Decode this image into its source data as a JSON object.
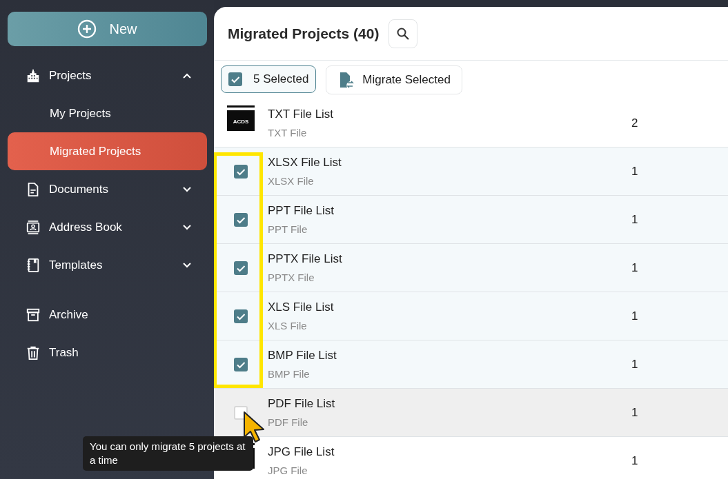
{
  "sidebar": {
    "new_button": "New",
    "items": [
      {
        "label": "Projects",
        "expanded": true,
        "children": [
          {
            "label": "My Projects",
            "selected": false
          },
          {
            "label": "Migrated Projects",
            "selected": true
          }
        ]
      },
      {
        "label": "Documents",
        "expanded": false
      },
      {
        "label": "Address Book",
        "expanded": false
      },
      {
        "label": "Templates",
        "expanded": false
      },
      {
        "label": "Archive"
      },
      {
        "label": "Trash"
      }
    ]
  },
  "main": {
    "title": "Migrated Projects (40)",
    "toolbar": {
      "selection_label": "5 Selected",
      "selection_checked": true,
      "migrate_button": "Migrate Selected"
    },
    "rows": [
      {
        "kind": "thumbnail",
        "thumb_label": "ACDS",
        "title": "TXT File List",
        "subtitle": "TXT File",
        "count": "2"
      },
      {
        "kind": "checkbox",
        "checked": true,
        "title": "XLSX File List",
        "subtitle": "XLSX File",
        "count": "1"
      },
      {
        "kind": "checkbox",
        "checked": true,
        "title": "PPT File List",
        "subtitle": "PPT File",
        "count": "1"
      },
      {
        "kind": "checkbox",
        "checked": true,
        "title": "PPTX File List",
        "subtitle": "PPTX File",
        "count": "1"
      },
      {
        "kind": "checkbox",
        "checked": true,
        "title": "XLS File List",
        "subtitle": "XLS File",
        "count": "1"
      },
      {
        "kind": "checkbox",
        "checked": true,
        "title": "BMP File List",
        "subtitle": "BMP File",
        "count": "1"
      },
      {
        "kind": "checkbox",
        "checked": false,
        "hovered": true,
        "title": "PDF File List",
        "subtitle": "PDF File",
        "count": "1"
      },
      {
        "kind": "thumbnail",
        "title": "JPG File List",
        "subtitle": "JPG File",
        "count": "1"
      }
    ],
    "tooltip": "You can only migrate 5 projects at a time"
  }
}
